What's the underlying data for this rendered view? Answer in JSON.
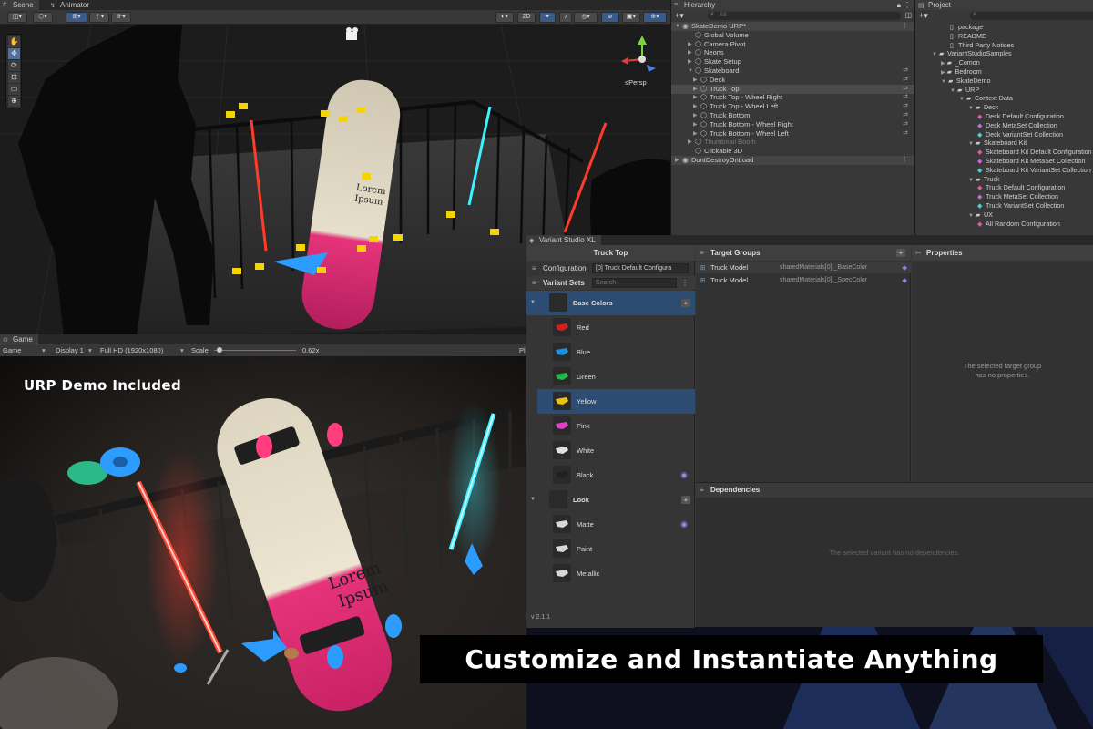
{
  "scene_panel": {
    "tabs": [
      "Scene",
      "Animator"
    ],
    "toolbar": {
      "view_2d": "2D"
    },
    "persp_label": "≤Persp"
  },
  "hierarchy": {
    "tab": "Hierarchy",
    "search_placeholder": "All",
    "rows": [
      {
        "label": "SkateDemo URP*",
        "indent": 0,
        "kind": "scene",
        "arrow": "▼"
      },
      {
        "label": "Global Volume",
        "indent": 2,
        "arrow": ""
      },
      {
        "label": "Camera Pivot",
        "indent": 2,
        "arrow": "▶"
      },
      {
        "label": "Neons",
        "indent": 2,
        "arrow": "▶"
      },
      {
        "label": "Skate Setup",
        "indent": 2,
        "arrow": "▶"
      },
      {
        "label": "Skateboard",
        "indent": 2,
        "arrow": "▼",
        "right": "⇄"
      },
      {
        "label": "Deck",
        "indent": 3,
        "arrow": "▶",
        "right": "⇄"
      },
      {
        "label": "Truck Top",
        "indent": 3,
        "arrow": "▶",
        "right": "⇄",
        "sel": true
      },
      {
        "label": "Truck Top - Wheel Right",
        "indent": 3,
        "arrow": "▶",
        "right": "⇄"
      },
      {
        "label": "Truck Top - Wheel Left",
        "indent": 3,
        "arrow": "▶",
        "right": "⇄"
      },
      {
        "label": "Truck Bottom",
        "indent": 3,
        "arrow": "▶",
        "right": "⇄"
      },
      {
        "label": "Truck Bottom - Wheel Right",
        "indent": 3,
        "arrow": "▶",
        "right": "⇄"
      },
      {
        "label": "Truck Bottom - Wheel Left",
        "indent": 3,
        "arrow": "▶",
        "right": "⇄"
      },
      {
        "label": "Thumbnail Booth",
        "indent": 2,
        "arrow": "▶",
        "dim": true
      },
      {
        "label": "Clickable 3D",
        "indent": 2,
        "arrow": ""
      },
      {
        "label": "DontDestroyOnLoad",
        "indent": 0,
        "kind": "scene",
        "arrow": "▶"
      }
    ]
  },
  "project": {
    "tab": "Project",
    "rows": [
      {
        "label": "package",
        "indent": 3,
        "icon": "file"
      },
      {
        "label": "README",
        "indent": 3,
        "icon": "file"
      },
      {
        "label": "Third Party Notices",
        "indent": 3,
        "icon": "file"
      },
      {
        "label": "VariantStudioSamples",
        "indent": 1,
        "icon": "folder",
        "arrow": "▼"
      },
      {
        "label": "_Comon",
        "indent": 2,
        "icon": "folder",
        "arrow": "▶"
      },
      {
        "label": "Bedroom",
        "indent": 2,
        "icon": "folder",
        "arrow": "▶"
      },
      {
        "label": "SkateDemo",
        "indent": 2,
        "icon": "folder",
        "arrow": "▼"
      },
      {
        "label": "URP",
        "indent": 3,
        "icon": "folder",
        "arrow": "▼"
      },
      {
        "label": "Context Data",
        "indent": 4,
        "icon": "folder",
        "arrow": "▼"
      },
      {
        "label": "Deck",
        "indent": 5,
        "icon": "folder",
        "arrow": "▼"
      },
      {
        "label": "Deck Default Configuration",
        "indent": 6,
        "icon": "cfg"
      },
      {
        "label": "Deck MetaSet Collection",
        "indent": 6,
        "icon": "meta"
      },
      {
        "label": "Deck VariantSet Collection",
        "indent": 6,
        "icon": "var"
      },
      {
        "label": "Skateboard Kit",
        "indent": 5,
        "icon": "folder",
        "arrow": "▼"
      },
      {
        "label": "Skateboard Kit Default Configuration",
        "indent": 6,
        "icon": "cfg"
      },
      {
        "label": "Skateboard Kit MetaSet Collection",
        "indent": 6,
        "icon": "meta"
      },
      {
        "label": "Skateboard Kit VariantSet Collection",
        "indent": 6,
        "icon": "var"
      },
      {
        "label": "Truck",
        "indent": 5,
        "icon": "folder",
        "arrow": "▼"
      },
      {
        "label": "Truck Default Configuration",
        "indent": 6,
        "icon": "cfg"
      },
      {
        "label": "Truck MetaSet Collection",
        "indent": 6,
        "icon": "meta"
      },
      {
        "label": "Truck VariantSet Collection",
        "indent": 6,
        "icon": "var"
      },
      {
        "label": "UX",
        "indent": 5,
        "icon": "folder",
        "arrow": "▼"
      },
      {
        "label": "All Random Configuration",
        "indent": 6,
        "icon": "cfg"
      }
    ]
  },
  "game": {
    "tab": "Game",
    "display_mode": "Game",
    "display": "Display 1",
    "resolution": "Full HD (1920x1080)",
    "scale_label": "Scale",
    "scale_value": "0.62x",
    "scale_fraction": 0.62,
    "overlay_title": "URP Demo Included",
    "deck_text_line1": "Lorem",
    "deck_text_line2": "Ipsum"
  },
  "scene_view": {
    "deck_text_line1": "Lorem",
    "deck_text_line2": "Ipsum"
  },
  "variant_studio": {
    "tab": "Variant Studio XL",
    "object_title": "Truck Top",
    "configuration_label": "Configuration",
    "configuration_value": "[0] Truck Default Configura",
    "variant_sets_label": "Variant Sets",
    "search_placeholder": "Search",
    "sets": [
      {
        "name": "Base Colors",
        "variants": [
          {
            "name": "Red",
            "color": "#d42020"
          },
          {
            "name": "Blue",
            "color": "#1e90e0"
          },
          {
            "name": "Green",
            "color": "#22b84a"
          },
          {
            "name": "Yellow",
            "color": "#e6c21a",
            "selected": true
          },
          {
            "name": "Pink",
            "color": "#e040c8"
          },
          {
            "name": "White",
            "color": "#e0e0e0"
          },
          {
            "name": "Black",
            "color": "#202020",
            "eye": true
          }
        ]
      },
      {
        "name": "Look",
        "variants": [
          {
            "name": "Matte",
            "color": "#d8d8d8",
            "eye": true
          },
          {
            "name": "Paint",
            "color": "#d8d8d8"
          },
          {
            "name": "Metallic",
            "color": "#d8d8d8"
          }
        ]
      }
    ],
    "version": "v 2.1.1",
    "target_groups": {
      "title": "Target Groups",
      "rows": [
        {
          "model": "Truck Model",
          "property": "sharedMaterials[0]._BaseColor"
        },
        {
          "model": "Truck Model",
          "property": "sharedMaterials[0]._SpecColor"
        }
      ]
    },
    "properties": {
      "title": "Properties",
      "empty_line1": "The selected target group",
      "empty_line2": "has no properties."
    },
    "dependencies": {
      "title": "Dependencies",
      "empty": "The selected variant has no dependencies."
    }
  },
  "banner": {
    "text": "Customize and Instantiate Anything"
  },
  "colors": {
    "accent": "#2c4c72",
    "neon_red": "#ff3b2b",
    "neon_cyan": "#3ff2ff",
    "deck_pink": "#e6337a",
    "wheel_pink": "#ff3d7f",
    "wheel_blue": "#2d9cff"
  }
}
